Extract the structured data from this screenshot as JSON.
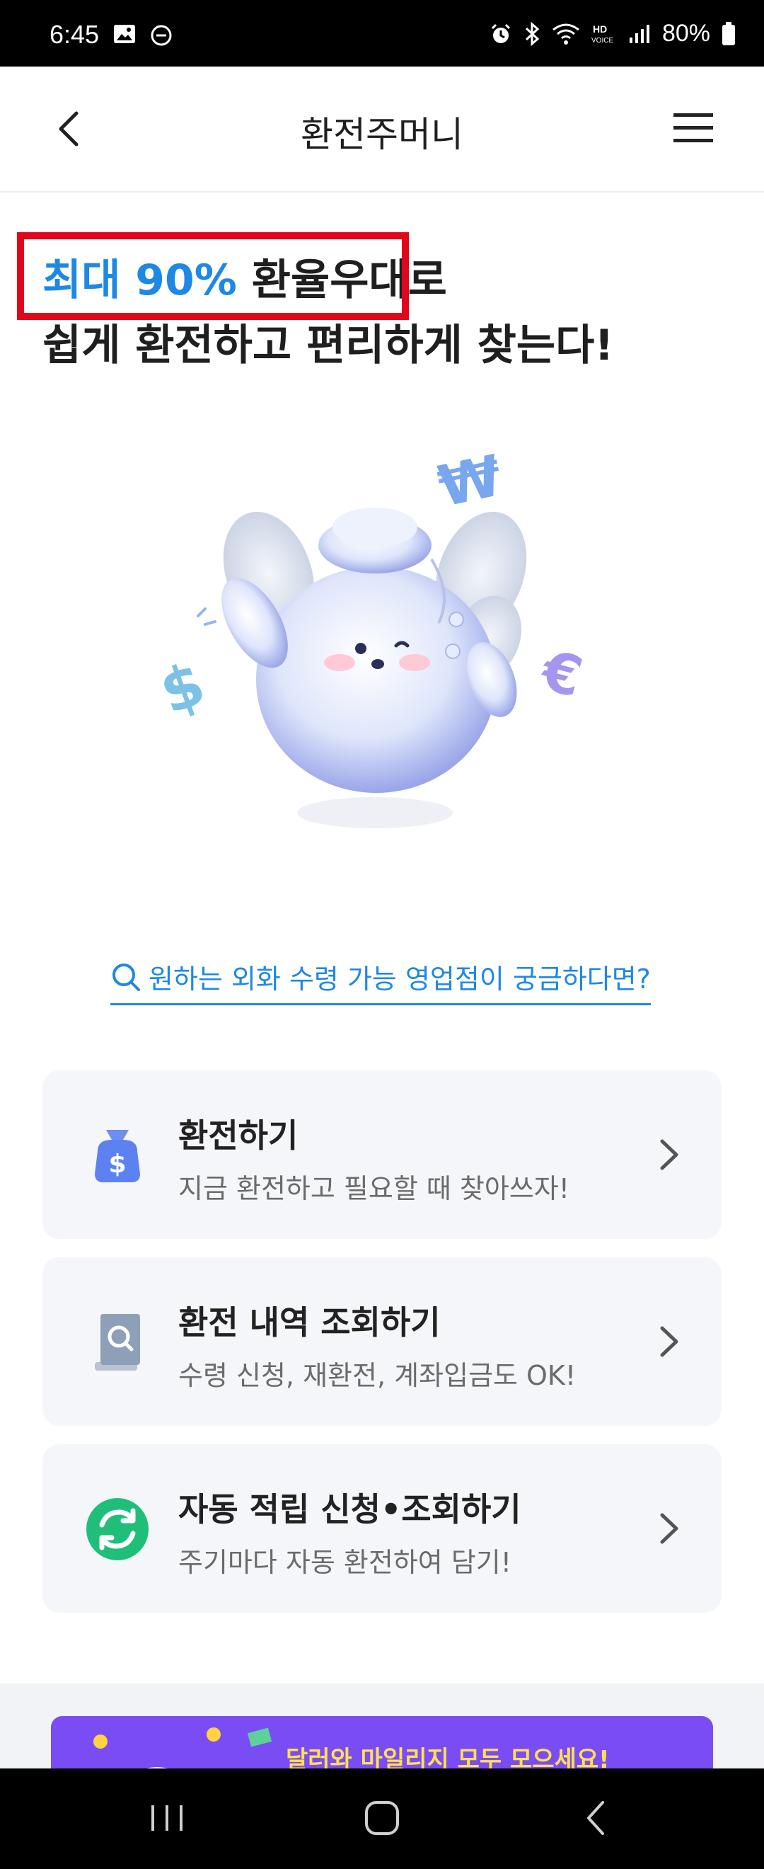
{
  "status_bar": {
    "time": "6:45",
    "battery": "80%",
    "icons": [
      "gallery-icon",
      "dnd-icon",
      "alarm-icon",
      "bluetooth-icon",
      "wifi-icon",
      "hd-voice-icon",
      "signal-icon",
      "battery-icon"
    ]
  },
  "appbar": {
    "title": "환전주머니",
    "back_icon": "back-chevron-icon",
    "menu_icon": "hamburger-menu-icon"
  },
  "headline": {
    "accent": "최대 90%",
    "line1_rest": " 환율우대로",
    "line2": "쉽게 환전하고 편리하게 찾는다!"
  },
  "link": {
    "text": "원하는 외화 수령 가능 영업점이 궁금하다면?"
  },
  "cards": [
    {
      "title": "환전하기",
      "desc": "지금 환전하고 필요할 때 찾아쓰자!",
      "icon": "money-bag-icon"
    },
    {
      "title": "환전 내역 조회하기",
      "desc": "수령 신청, 재환전, 계좌입금도 OK!",
      "icon": "document-search-icon"
    },
    {
      "title": "자동 적립 신청•조회하기",
      "desc": "주기마다 자동 환전하여 담기!",
      "icon": "auto-refresh-icon"
    }
  ],
  "banner": {
    "text": "달러와 마일리지 모두 모으세요!"
  },
  "colors": {
    "accent": "#1e88e5",
    "highlight": "#e1061b",
    "banner_bg": "#7a4cf4",
    "banner_text": "#ffe14d",
    "card_bg": "#f5f6f9"
  }
}
